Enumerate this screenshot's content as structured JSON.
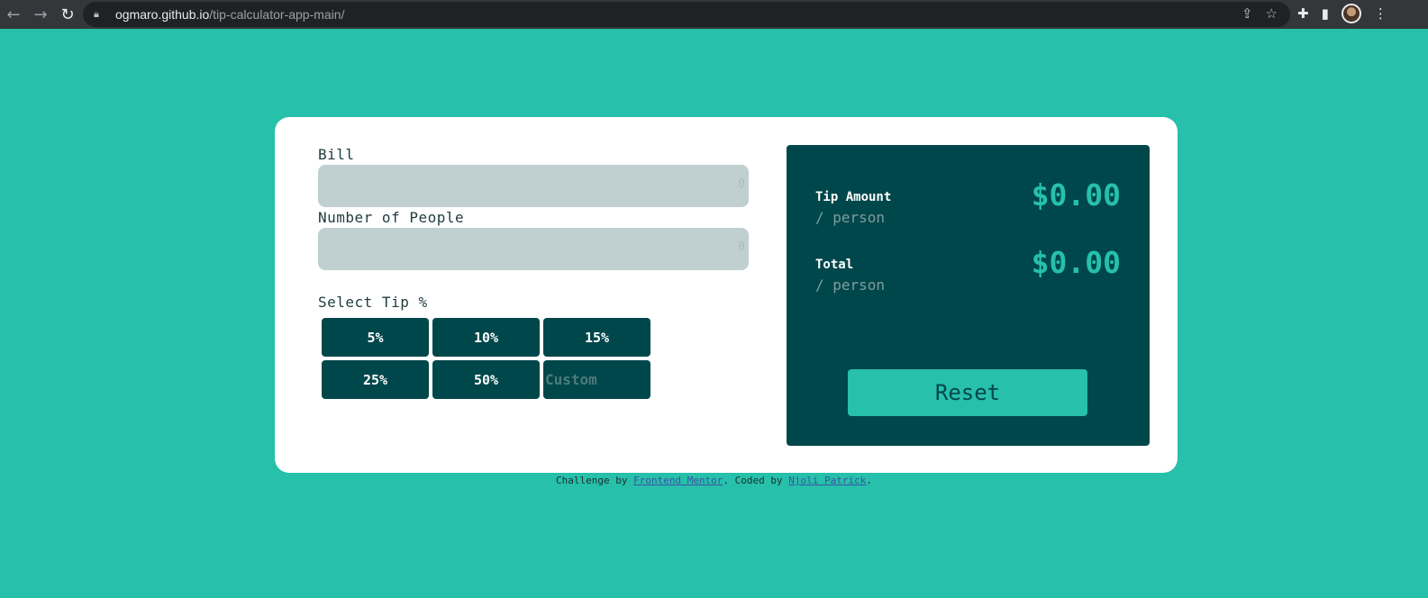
{
  "browser": {
    "back_icon": "arrow-left-icon",
    "forward_icon": "arrow-right-icon",
    "reload_icon": "reload-icon",
    "url_host": "ogmaro.github.io",
    "url_path": "/tip-calculator-app-main/"
  },
  "form": {
    "bill_label": "Bill",
    "bill_placeholder": "0",
    "people_label": "Number of People",
    "people_placeholder": "0",
    "tip_label": "Select Tip %",
    "tips": [
      "5%",
      "10%",
      "15%",
      "25%",
      "50%"
    ],
    "custom_placeholder": "Custom"
  },
  "results": {
    "tip_title": "Tip Amount",
    "tip_sub": "/ person",
    "tip_value": "$0.00",
    "total_title": "Total",
    "total_sub": "/ person",
    "total_value": "$0.00",
    "reset_label": "Reset"
  },
  "footer": {
    "prefix": "Challenge by ",
    "link1": "Frontend Mentor",
    "middle": ". Coded by ",
    "link2": "Njoli Patrick",
    "suffix": "."
  },
  "colors": {
    "background": "#26c0ab",
    "panel": "#00474b",
    "field": "#c0d0d0",
    "accent": "#26c0ab"
  }
}
